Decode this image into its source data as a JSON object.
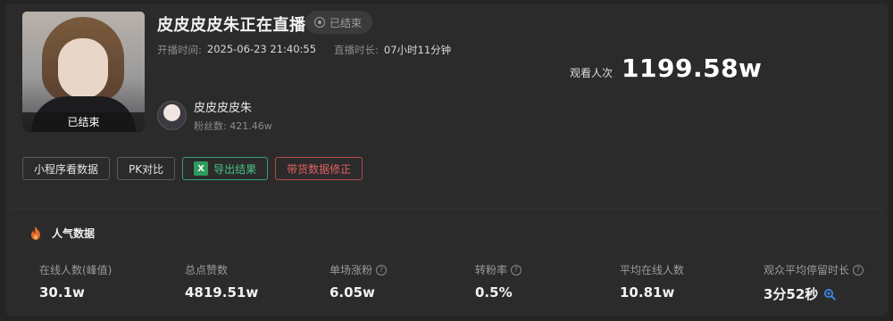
{
  "live": {
    "title": "皮皮皮皮朱正在直播",
    "status": "已结束",
    "cover_status": "已结束",
    "start_label": "开播时间:",
    "start_time": "2025-06-23 21:40:55",
    "duration_label": "直播时长:",
    "duration": "07小时11分钟"
  },
  "author": {
    "name": "皮皮皮皮朱",
    "fans_label": "粉丝数:",
    "fans": "421.46w"
  },
  "viewers": {
    "label": "观看人次",
    "value": "1199.58w"
  },
  "buttons": {
    "mini_program": "小程序看数据",
    "pk": "PK对比",
    "export": "导出结果",
    "fix": "带货数据修正"
  },
  "section": {
    "title": "人气数据"
  },
  "stats": [
    {
      "label": "在线人数(峰值)",
      "value": "30.1w"
    },
    {
      "label": "总点赞数",
      "value": "4819.51w"
    },
    {
      "label": "单场涨粉",
      "value": "6.05w"
    },
    {
      "label": "转粉率",
      "value": "0.5%"
    },
    {
      "label": "平均在线人数",
      "value": "10.81w"
    },
    {
      "label": "观众平均停留时长",
      "value": "3分52秒"
    }
  ],
  "colors": {
    "background": "#2b2b2c",
    "export_accent": "#4cc185",
    "fix_accent": "#e06060",
    "fire": "#e5692b"
  },
  "icons": [
    "status-dot-icon",
    "excel-icon",
    "fire-icon",
    "help-icon",
    "zoom-icon"
  ]
}
